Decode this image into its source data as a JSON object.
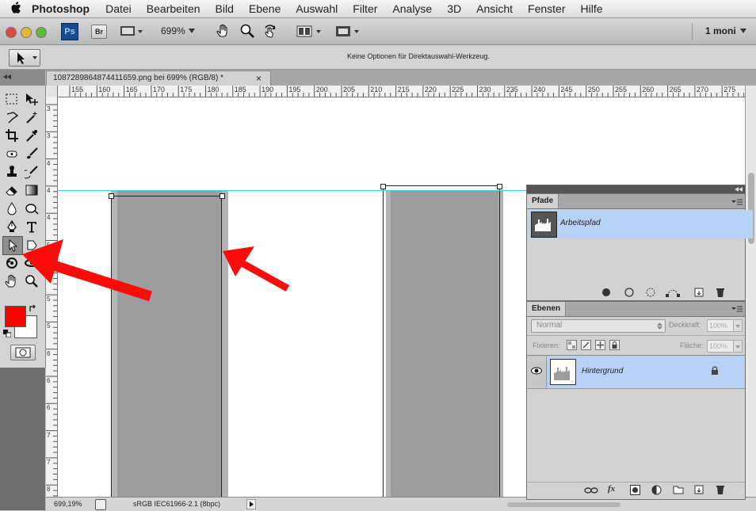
{
  "menubar": {
    "app_name": "Photoshop",
    "items": [
      "Datei",
      "Bearbeiten",
      "Bild",
      "Ebene",
      "Auswahl",
      "Filter",
      "Analyse",
      "3D",
      "Ansicht",
      "Fenster",
      "Hilfe"
    ]
  },
  "appbar": {
    "ps_label": "Ps",
    "br_label": "Br",
    "zoom": "699%",
    "workspace": "1 moni"
  },
  "options": {
    "message": "Keine Optionen für Direktauswahl-Werkzeug."
  },
  "document": {
    "tab_title": "1087289864874411659.png bei 699% (RGB/8) *",
    "close_glyph": "×"
  },
  "ruler": {
    "h_labels": [
      "155",
      "160",
      "165",
      "170",
      "175",
      "180",
      "185",
      "190",
      "195",
      "200",
      "205",
      "210",
      "215",
      "220",
      "225",
      "230",
      "235",
      "240",
      "245",
      "250",
      "255",
      "260",
      "265",
      "270",
      "275"
    ],
    "v_labels": [
      "3",
      "3",
      "4",
      "4",
      "4",
      "5",
      "5",
      "5",
      "5",
      "6",
      "6",
      "6",
      "7",
      "7",
      "8",
      "8"
    ]
  },
  "status": {
    "zoom": "699,19%",
    "profile": "sRGB IEC61966-2.1 (8bpc)"
  },
  "paths_panel": {
    "tab": "Pfade",
    "item_label": "Arbeitspfad"
  },
  "layers_panel": {
    "tab": "Ebenen",
    "blend_mode": "Normal",
    "opacity_label": "Deckkraft:",
    "opacity_value": "100%",
    "lock_label": "Fixieren:",
    "fill_label": "Fläche:",
    "fill_value": "100%",
    "layer_name": "Hintergrund"
  },
  "colors": {
    "foreground": "#ff0000",
    "background": "#ffffff",
    "selection": "#b7d2f5",
    "guide": "#36d6e8",
    "bar_fill": "#9d9d9d",
    "bar_edge": "#b4b4b4",
    "arrow": "#ff0a0a"
  }
}
